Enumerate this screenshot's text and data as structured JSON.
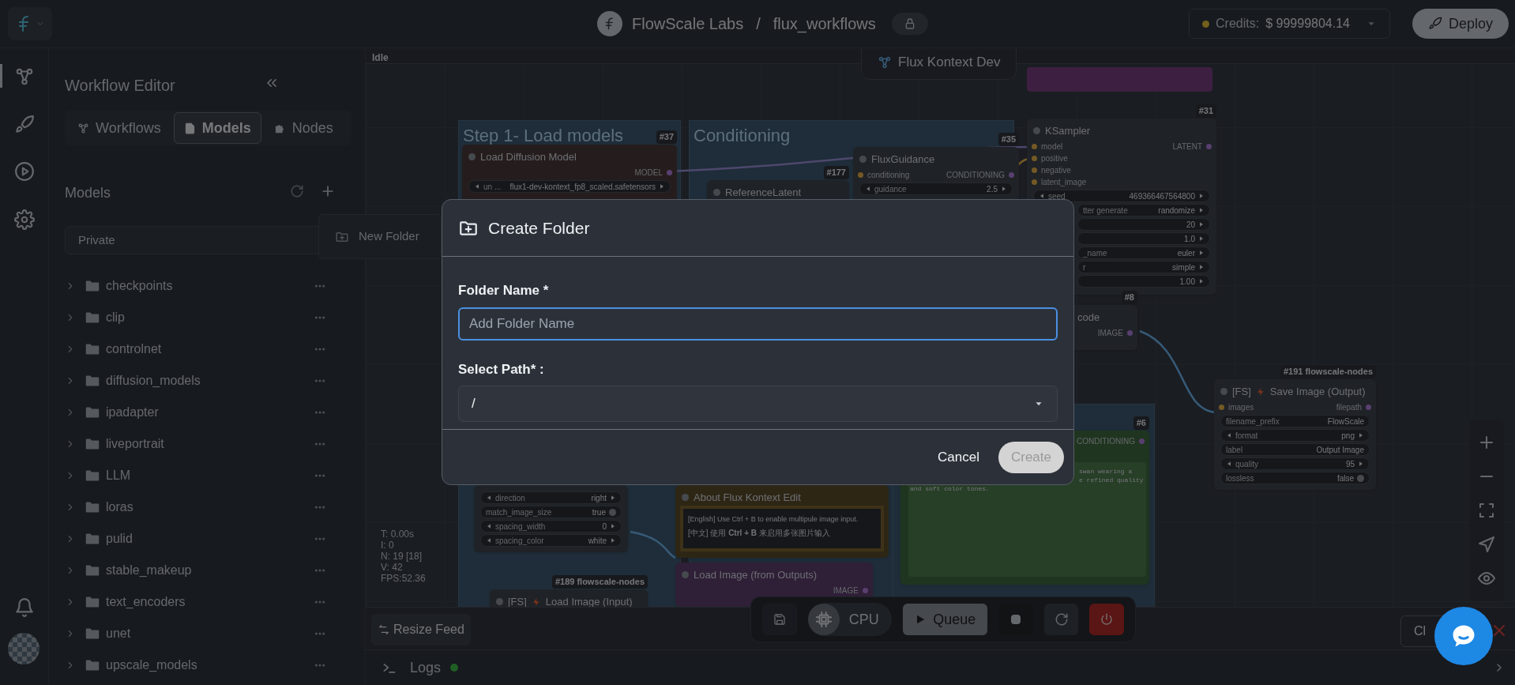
{
  "top_bar": {
    "workspace": "FlowScale Labs",
    "separator": "/",
    "project": "flux_workflows",
    "credits_label": "Credits:",
    "credits_value": "$ 99999804.14",
    "deploy": "Deploy"
  },
  "sidebar": {
    "title": "Workflow Editor",
    "tabs": [
      {
        "label": "Workflows",
        "selected": false
      },
      {
        "label": "Models",
        "selected": true
      },
      {
        "label": "Nodes",
        "selected": false
      }
    ],
    "section_title": "Models",
    "filter": "Private",
    "folders": [
      {
        "name": "checkpoints",
        "expanded": false
      },
      {
        "name": "clip",
        "expanded": false
      },
      {
        "name": "controlnet",
        "expanded": false
      },
      {
        "name": "diffusion_models",
        "expanded": false
      },
      {
        "name": "ipadapter",
        "expanded": false
      },
      {
        "name": "liveportrait",
        "expanded": false
      },
      {
        "name": "LLM",
        "expanded": false
      },
      {
        "name": "loras",
        "expanded": false
      },
      {
        "name": "pulid",
        "expanded": false
      },
      {
        "name": "stable_makeup",
        "expanded": false
      },
      {
        "name": "text_encoders",
        "expanded": false
      },
      {
        "name": "unet",
        "expanded": false
      },
      {
        "name": "upscale_models",
        "expanded": false
      }
    ],
    "menu": [
      {
        "label": "New Folder"
      }
    ]
  },
  "canvas": {
    "status": "Idle",
    "workflow_name": "Flux Kontext Dev",
    "groups": [
      {
        "title": "Step 1- Load models"
      },
      {
        "title": "Conditioning"
      }
    ],
    "nodes": [
      {
        "kind": "loader",
        "badge": "#37",
        "title": "Load Diffusion Model",
        "outputs": [
          "MODEL"
        ],
        "widgets": [
          {
            "kind": "combo",
            "label": "un ...",
            "value": "flux1-dev-kontext_fp8_scaled.safetensors"
          }
        ]
      },
      {
        "kind": "default",
        "badge": "#177",
        "title": "ReferenceLatent"
      },
      {
        "kind": "default",
        "badge": "#35",
        "title": "FluxGuidance",
        "inputs": [
          "conditioning"
        ],
        "outputs": [
          "CONDITIONING"
        ],
        "widgets": [
          {
            "kind": "combo",
            "label": "guidance",
            "value": "2.5"
          }
        ]
      },
      {
        "kind": "default",
        "badge": "#31",
        "title": "KSampler",
        "inputs": [
          "model",
          "positive",
          "negative",
          "latent_image"
        ],
        "outputs": [
          "LATENT"
        ],
        "widgets": [
          {
            "kind": "combo",
            "label": "seed",
            "value": "469366467564800"
          },
          {
            "kind": "combo",
            "label": "tter generate",
            "value": "randomize"
          },
          {
            "kind": "combo",
            "value": "20"
          },
          {
            "kind": "combo",
            "value": "1.0"
          },
          {
            "kind": "combo",
            "label": "_name",
            "value": "euler"
          },
          {
            "kind": "combo",
            "label": "r",
            "value": "simple"
          },
          {
            "kind": "combo",
            "value": "1.00"
          }
        ]
      },
      {
        "kind": "default",
        "badge": "#8",
        "title": "code",
        "outputs": [
          "IMAGE"
        ]
      },
      {
        "kind": "default",
        "badge": "#191 flowscale-nodes",
        "prefix": "[FS]",
        "title": "Save Image (Output)",
        "inputs": [
          "images"
        ],
        "outputs": [
          "filepath"
        ],
        "widgets": [
          {
            "kind": "text",
            "label": "filename_prefix",
            "value": "FlowScale"
          },
          {
            "kind": "combo",
            "label": "format",
            "value": "png"
          },
          {
            "kind": "text",
            "label": "label",
            "value": "Output Image"
          },
          {
            "kind": "combo",
            "label": "quality",
            "value": "95"
          },
          {
            "kind": "toggle",
            "label": "lossless",
            "value": "false"
          }
        ]
      },
      {
        "kind": "prompt",
        "badge": "#6",
        "outputs": [
          "CONDITIONING"
        ],
        "lines": [
          "swan wearing a",
          "e refined quality",
          "and soft color tones."
        ]
      },
      {
        "kind": "default",
        "widgets": [
          {
            "kind": "combo",
            "label": "direction",
            "value": "right"
          },
          {
            "kind": "toggle",
            "label": "match_image_size",
            "value": "true"
          },
          {
            "kind": "combo",
            "label": "spacing_width",
            "value": "0"
          },
          {
            "kind": "combo",
            "label": "spacing_color",
            "value": "white"
          }
        ]
      },
      {
        "kind": "note",
        "title": "About Flux Kontext Edit",
        "lines": [
          "[English] Use Ctrl + B to enable multipule image input.",
          "[中文] 使用 **Ctrl + B** 来启用多张图片输入"
        ]
      },
      {
        "kind": "image",
        "title": "Load Image (from Outputs)",
        "outputs": [
          "IMAGE"
        ]
      },
      {
        "kind": "default",
        "badge": "#189 flowscale-nodes",
        "prefix": "[FS]",
        "title": "Load Image (Input)"
      }
    ],
    "stats": [
      "T: 0.00s",
      "I: 0",
      "N: 19 [18]",
      "V: 42",
      "FPS:52.36"
    ]
  },
  "toolbar": {
    "device": "CPU",
    "queue": "Queue",
    "resize_feed": "Resize Feed",
    "close": "Cl"
  },
  "logs": {
    "label": "Logs"
  },
  "dialog": {
    "title": "Create Folder",
    "fields": [
      {
        "kind": "text",
        "label": "Folder Name *",
        "placeholder": "Add Folder Name",
        "focused": true
      },
      {
        "kind": "select",
        "label": "Select Path* :",
        "value": "/"
      }
    ],
    "buttons": [
      {
        "kind": "plain",
        "label": "Cancel",
        "disabled": false
      },
      {
        "kind": "primary",
        "label": "Create",
        "disabled": true
      }
    ]
  }
}
